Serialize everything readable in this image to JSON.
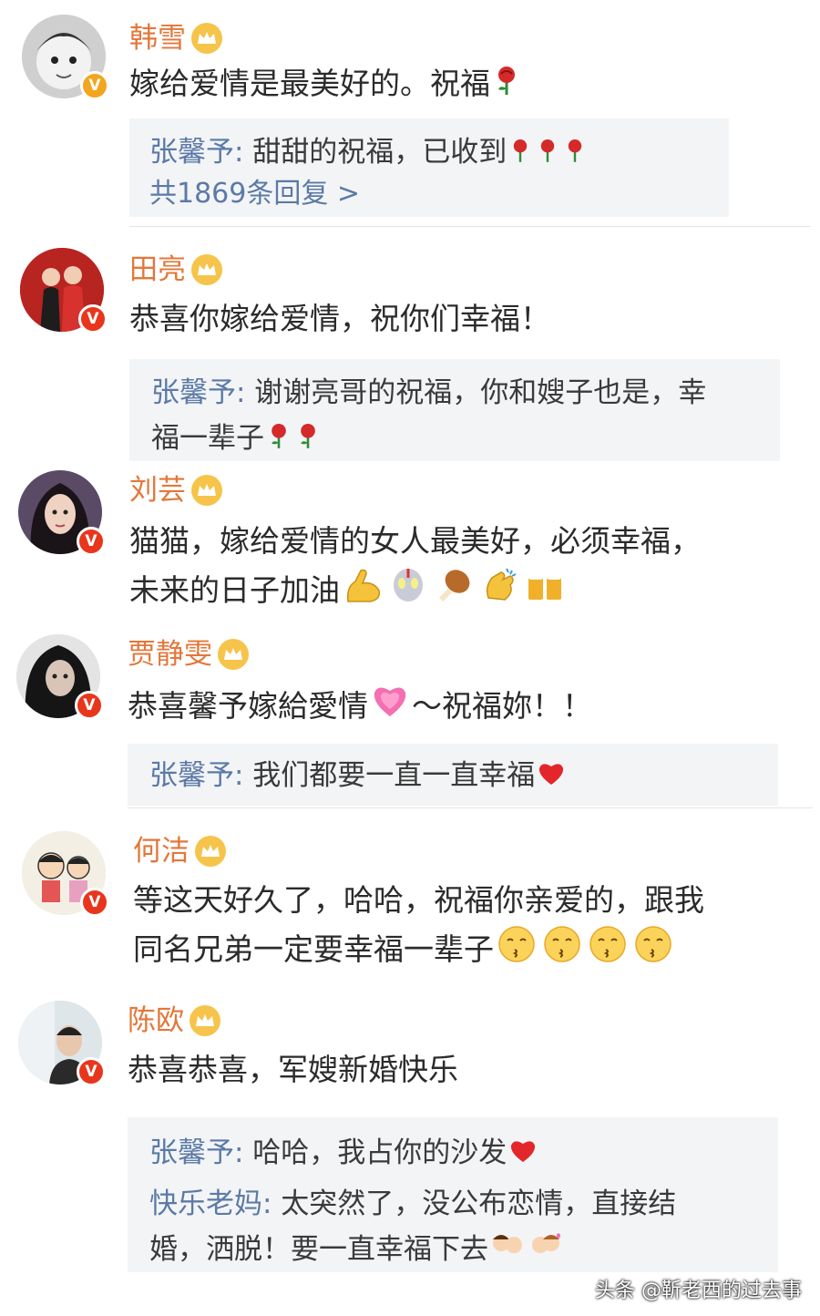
{
  "comments": [
    {
      "name": "韩雪",
      "text": "嫁给爱情是最美好的。祝福",
      "replies": [
        {
          "author": "张馨予:",
          "text": " 甜甜的祝福，已收到"
        }
      ],
      "more": "共1869条回复 >"
    },
    {
      "name": "田亮",
      "text": "恭喜你嫁给爱情，祝你们幸福！",
      "replies": [
        {
          "author": "张馨予:",
          "text": " 谢谢亮哥的祝福，你和嫂子也是，幸",
          "text2": "福一辈子"
        }
      ]
    },
    {
      "name": "刘芸",
      "text": "猫猫，嫁给爱情的女人最美好，必须幸福，",
      "text2": "未来的日子加油"
    },
    {
      "name": "贾静雯",
      "text": "恭喜馨予嫁給愛情",
      "text_tail": "～祝福妳！！",
      "replies": [
        {
          "author": "张馨予:",
          "text": " 我们都要一直一直幸福"
        }
      ]
    },
    {
      "name": "何洁",
      "text": "等这天好久了，哈哈，祝福你亲爱的，跟我",
      "text2": "同名兄弟一定要幸福一辈子"
    },
    {
      "name": "陈欧",
      "text": "恭喜恭喜，军嫂新婚快乐",
      "replies": [
        {
          "author": "张馨予:",
          "text": " 哈哈，我占你的沙发"
        },
        {
          "author": "快乐老妈:",
          "text": " 太突然了，没公布恋情，直接结",
          "text2": "婚，洒脱！要一直幸福下去"
        }
      ]
    }
  ],
  "watermark": "头条 @靳老西的过去事",
  "colors": {
    "name": "#e3773a",
    "reply_author": "#5b7aa6",
    "reply_bg": "#f3f4f6",
    "badge_orange": "#f3a51d",
    "badge_red": "#e8361d"
  }
}
